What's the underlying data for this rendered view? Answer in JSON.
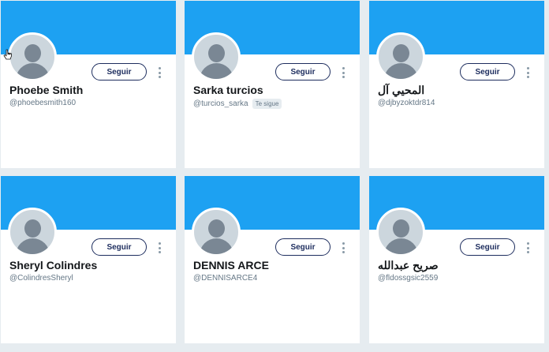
{
  "colors": {
    "banner": "#1da1f2",
    "button_border": "#1d2d5e",
    "page_background": "#e6ecf0"
  },
  "cards": [
    {
      "name": "Phoebe Smith",
      "handle": "@phoebesmith160",
      "button": "Seguir",
      "follows_you": ""
    },
    {
      "name": "Sarka turcios",
      "handle": "@turcios_sarka",
      "button": "Seguir",
      "follows_you": "Te sigue"
    },
    {
      "name": "المحيي آل",
      "handle": "@djbyzoktdr814",
      "button": "Seguir",
      "follows_you": ""
    },
    {
      "name": "Sheryl Colindres",
      "handle": "@ColindresSheryl",
      "button": "Seguir",
      "follows_you": ""
    },
    {
      "name": "DENNIS ARCE",
      "handle": "@DENNISARCE4",
      "button": "Seguir",
      "follows_you": ""
    },
    {
      "name": "صريح عبدالله",
      "handle": "@fldossgsic2559",
      "button": "Seguir",
      "follows_you": ""
    }
  ],
  "icons": {
    "avatar": "default-avatar-icon",
    "more": "more-vertical-icon",
    "cursor": "hand-pointer-icon"
  }
}
